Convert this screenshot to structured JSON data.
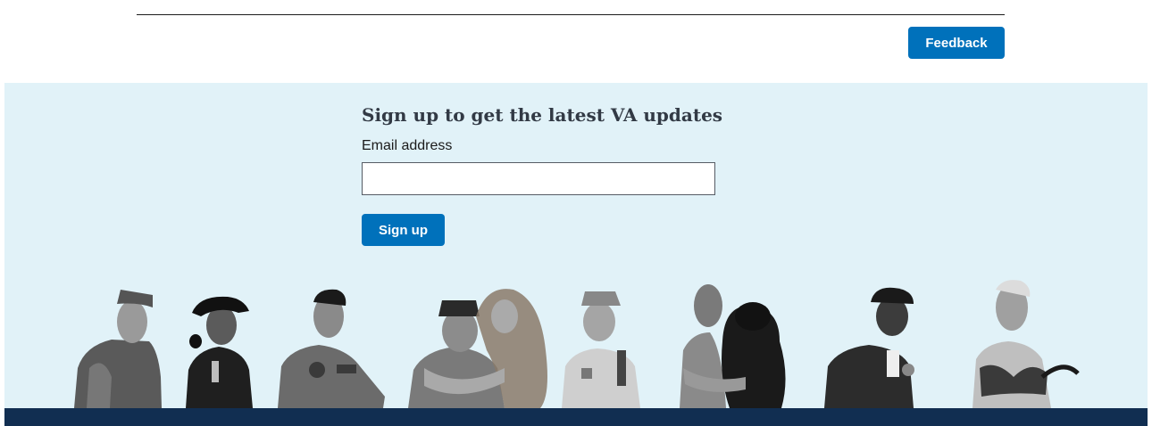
{
  "header": {
    "feedback_label": "Feedback"
  },
  "signup": {
    "heading": "Sign up to get the latest VA updates",
    "email_label": "Email address",
    "email_value": "",
    "button_label": "Sign up"
  },
  "colors": {
    "primary_button": "#0071bb",
    "signup_background": "#e1f2f8",
    "footer": "#112e51",
    "heading_text": "#323a45"
  },
  "illustration": {
    "description_icon": "veterans-photo-strip"
  }
}
